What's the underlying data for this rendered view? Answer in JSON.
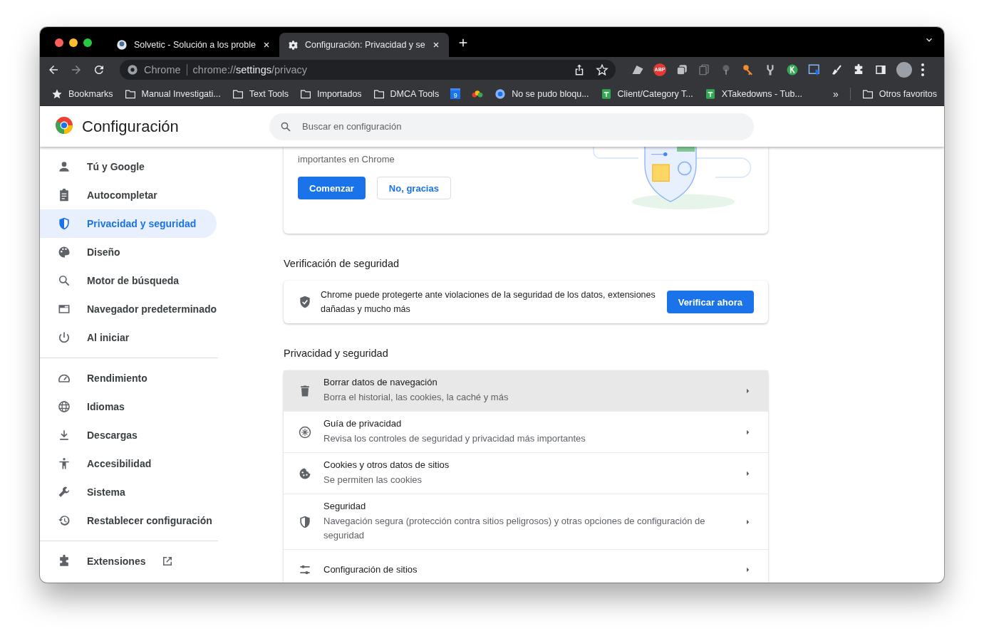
{
  "tabs": [
    {
      "title": "Solvetic - Solución a los proble",
      "kind": "site",
      "selected": false
    },
    {
      "title": "Configuración: Privacidad y se",
      "kind": "settings",
      "selected": true
    }
  ],
  "omnibox": {
    "chip": "Chrome",
    "scheme": "chrome://",
    "host": "settings",
    "path": "/privacy"
  },
  "extension_badge": "ABP",
  "bookmarks": [
    {
      "label": "Bookmarks",
      "kind": "star"
    },
    {
      "label": "Manual Investigati...",
      "kind": "folder"
    },
    {
      "label": "Text Tools",
      "kind": "folder"
    },
    {
      "label": "Importados",
      "kind": "folder"
    },
    {
      "label": "DMCA Tools",
      "kind": "folder"
    },
    {
      "label": "9",
      "kind": "calendar"
    },
    {
      "kind": "logo"
    },
    {
      "label": "No se pudo bloqu...",
      "kind": "site"
    },
    {
      "label": "Client/Category T...",
      "kind": "sheet"
    },
    {
      "label": "XTakedowns - Tub...",
      "kind": "sheet"
    }
  ],
  "bookmarks_overflow": "»",
  "other_bookmarks": "Otros favoritos",
  "header": {
    "title": "Configuración",
    "search_placeholder": "Buscar en configuración"
  },
  "sidebar": {
    "groups": [
      [
        {
          "label": "Tú y Google",
          "kind": "person",
          "selected": false
        },
        {
          "label": "Autocompletar",
          "kind": "clipboard",
          "selected": false
        },
        {
          "label": "Privacidad y seguridad",
          "kind": "shield",
          "selected": true
        },
        {
          "label": "Diseño",
          "kind": "palette",
          "selected": false
        },
        {
          "label": "Motor de búsqueda",
          "kind": "search",
          "selected": false
        },
        {
          "label": "Navegador predeterminado",
          "kind": "browser",
          "selected": false
        },
        {
          "label": "Al iniciar",
          "kind": "power",
          "selected": false
        }
      ],
      [
        {
          "label": "Rendimiento",
          "kind": "gauge",
          "selected": false
        },
        {
          "label": "Idiomas",
          "kind": "globe",
          "selected": false
        },
        {
          "label": "Descargas",
          "kind": "download",
          "selected": false
        },
        {
          "label": "Accesibilidad",
          "kind": "accessibility",
          "selected": false
        },
        {
          "label": "Sistema",
          "kind": "wrench",
          "selected": false
        },
        {
          "label": "Restablecer configuración",
          "kind": "history",
          "selected": false
        }
      ]
    ],
    "extensions": "Extensiones"
  },
  "guide_card": {
    "text": "importantes en Chrome",
    "buttons": [
      {
        "label": "Comenzar",
        "kind": "primary"
      },
      {
        "label": "No, gracias",
        "kind": "secondary"
      }
    ]
  },
  "safety_check": {
    "heading": "Verificación de seguridad",
    "text": "Chrome puede protegerte ante violaciones de la seguridad de los datos, extensiones dañadas y mucho más",
    "button": "Verificar ahora"
  },
  "privacy": {
    "heading": "Privacidad y seguridad",
    "rows": [
      {
        "title": "Borrar datos de navegación",
        "subtitle": "Borra el historial, las cookies, la caché y más",
        "kind": "trash",
        "hovered": true
      },
      {
        "title": "Guía de privacidad",
        "subtitle": "Revisa los controles de seguridad y privacidad más importantes",
        "kind": "compass",
        "hovered": false
      },
      {
        "title": "Cookies y otros datos de sitios",
        "subtitle": "Se permiten las cookies",
        "kind": "cookie",
        "hovered": false
      },
      {
        "title": "Seguridad",
        "subtitle": "Navegación segura (protección contra sitios peligrosos) y otras opciones de configuración de seguridad",
        "kind": "shield-half",
        "hovered": false
      },
      {
        "title": "Configuración de sitios",
        "kind": "sliders",
        "hovered": false
      }
    ]
  }
}
